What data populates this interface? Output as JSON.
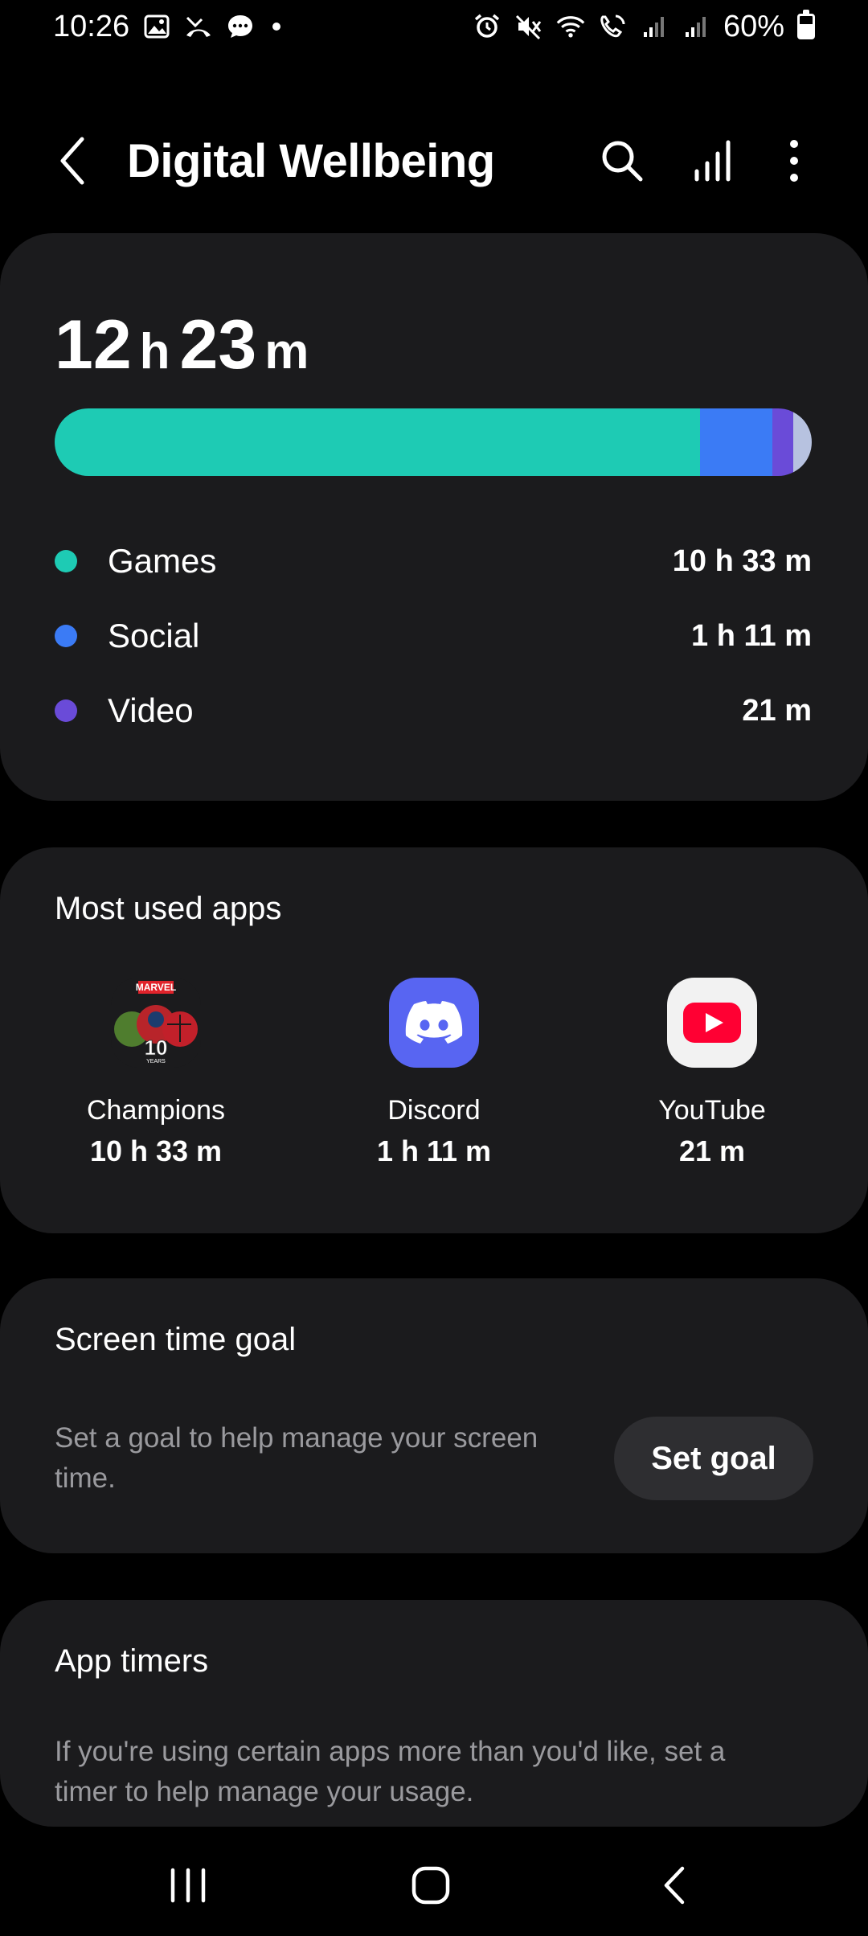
{
  "status_bar": {
    "time": "10:26",
    "battery_text": "60%",
    "battery_level": 0.6
  },
  "header": {
    "title": "Digital Wellbeing",
    "back_icon": "back-arrow-icon",
    "actions": [
      "search-icon",
      "stats-icon",
      "more-options-icon"
    ]
  },
  "usage": {
    "total_hours": "12",
    "hour_unit": "h",
    "total_minutes": "23",
    "minute_unit": "m",
    "categories": [
      {
        "label": "Games",
        "value": "10 h 33 m",
        "color": "#1ecbb4",
        "minutes": 633
      },
      {
        "label": "Social",
        "value": "1 h 11 m",
        "color": "#3b7bf5",
        "minutes": 71
      },
      {
        "label": "Video",
        "value": "21 m",
        "color": "#6a4bd8",
        "minutes": 21
      },
      {
        "label": "",
        "value": "",
        "color": "#b7c2e0",
        "minutes": 18
      }
    ]
  },
  "most_used": {
    "title": "Most used apps",
    "apps": [
      {
        "name": "Champions",
        "time": "10 h 33 m",
        "icon": "marvel-champions-icon",
        "badge_brand": "MARVEL",
        "badge_number": "10",
        "badge_sub": "YEARS"
      },
      {
        "name": "Discord",
        "time": "1 h 11 m",
        "icon": "discord-icon"
      },
      {
        "name": "YouTube",
        "time": "21 m",
        "icon": "youtube-icon"
      }
    ]
  },
  "screen_time_goal": {
    "title": "Screen time goal",
    "description_line1": "Set a goal to help manage your screen",
    "description_line2": "time.",
    "button_label": "Set goal"
  },
  "app_timers": {
    "title": "App timers",
    "description_line1": "If you're using certain apps more than you'd like, set a",
    "description_line2": "timer to help manage your usage."
  },
  "nav_bar": {
    "buttons": [
      "recents-icon",
      "home-icon",
      "back-icon"
    ]
  },
  "colors": {
    "background": "#000000",
    "card": "#1b1b1d",
    "muted_text": "#9a9a9e",
    "button_bg": "#2e2e31"
  }
}
